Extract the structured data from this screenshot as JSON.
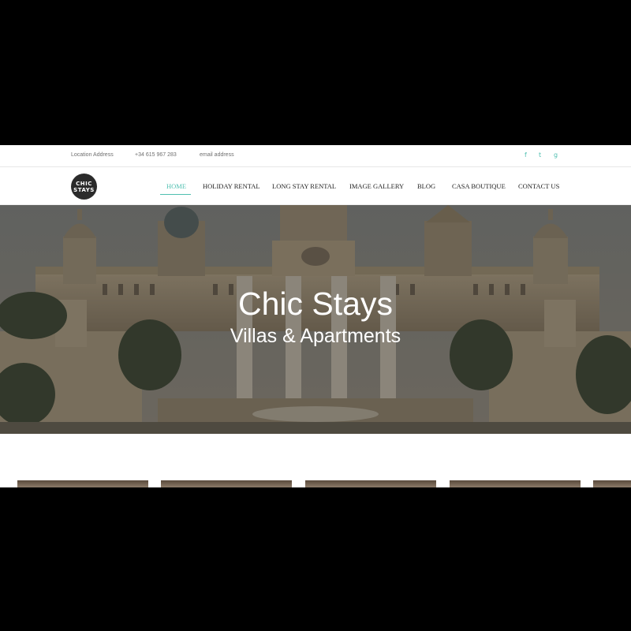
{
  "topbar": {
    "location": "Location Address",
    "phone": "+34 615 967 283",
    "email": "email address",
    "social": [
      {
        "icon": "facebook-icon",
        "glyph": "f"
      },
      {
        "icon": "twitter-icon",
        "glyph": "t"
      },
      {
        "icon": "google-icon",
        "glyph": "g"
      }
    ]
  },
  "logo": {
    "line1": "CHIC",
    "line2": "STAYS"
  },
  "nav": {
    "items": [
      {
        "label": "HOME",
        "active": true
      },
      {
        "label": "HOLIDAY RENTAL"
      },
      {
        "label": "LONG STAY RENTAL"
      },
      {
        "label": "IMAGE GALLERY"
      },
      {
        "label": "BLOG"
      },
      {
        "label": "CASA BOUTIQUE"
      },
      {
        "label": "CONTACT US"
      }
    ]
  },
  "hero": {
    "title": "Chic Stays",
    "subtitle": "Villas & Apartments"
  },
  "colors": {
    "accent": "#4fbfb0",
    "text": "#222222",
    "muted": "#6f6f6f"
  }
}
